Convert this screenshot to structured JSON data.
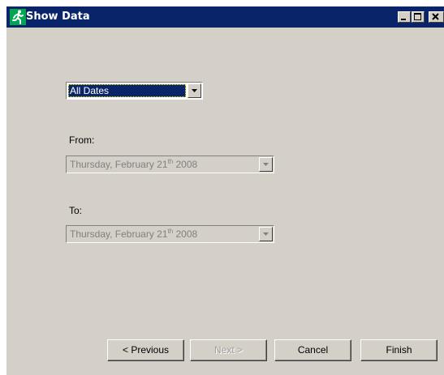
{
  "window": {
    "title": "Show Data",
    "icon": "running-man-icon",
    "controls": [
      "minimize-icon",
      "maximize-icon",
      "close-icon"
    ]
  },
  "date_mode": {
    "selected": "All Dates"
  },
  "from": {
    "label": "From:",
    "date_prefix": "Thursday, February 21",
    "date_suffix": "th",
    "date_year": " 2008",
    "enabled": false
  },
  "to": {
    "label": "To:",
    "date_prefix": "Thursday, February 21",
    "date_suffix": "th",
    "date_year": " 2008",
    "enabled": false
  },
  "buttons": {
    "previous": "< Previous",
    "next": "Next >",
    "cancel": "Cancel",
    "finish": "Finish"
  },
  "colors": {
    "titlebar": "#0a246a",
    "face": "#d4d0c8",
    "icon_green": "#00a651"
  }
}
